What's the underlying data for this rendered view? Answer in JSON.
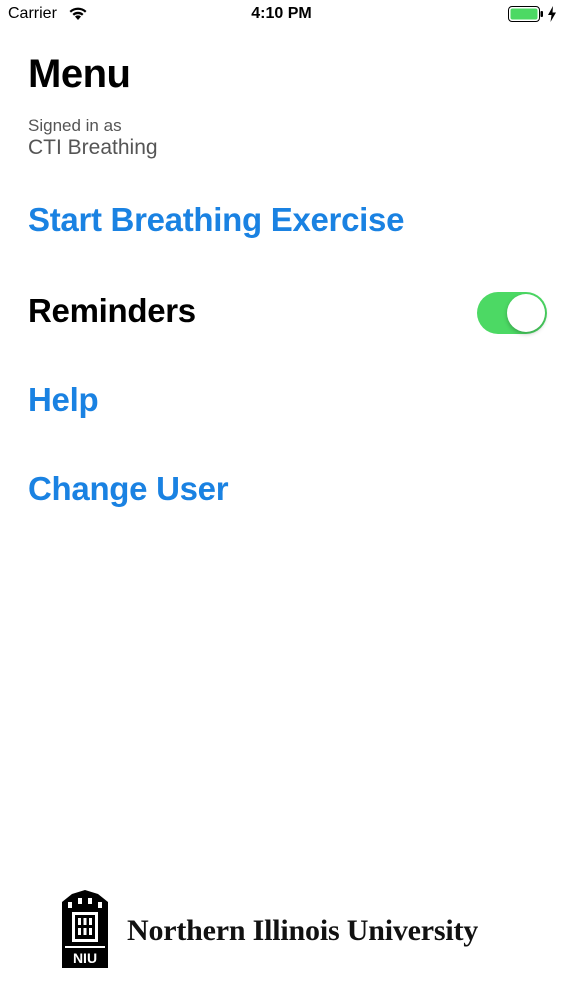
{
  "status_bar": {
    "carrier": "Carrier",
    "time": "4:10 PM",
    "wifi_icon": "wifi-icon",
    "battery_icon": "battery-full-icon",
    "charging_icon": "charging-bolt-icon",
    "battery_color": "#4cd964"
  },
  "header": {
    "title": "Menu",
    "signed_in_label": "Signed in as",
    "signed_in_user": "CTI Breathing"
  },
  "menu": {
    "start_exercise": "Start Breathing Exercise",
    "reminders": "Reminders",
    "reminders_enabled": true,
    "help": "Help",
    "change_user": "Change User"
  },
  "footer": {
    "university_name": "Northern Illinois University",
    "logo_text": "NIU"
  },
  "colors": {
    "link": "#1a82e2",
    "toggle_on": "#4cd964",
    "text": "#000000",
    "secondary_text": "#555555"
  }
}
